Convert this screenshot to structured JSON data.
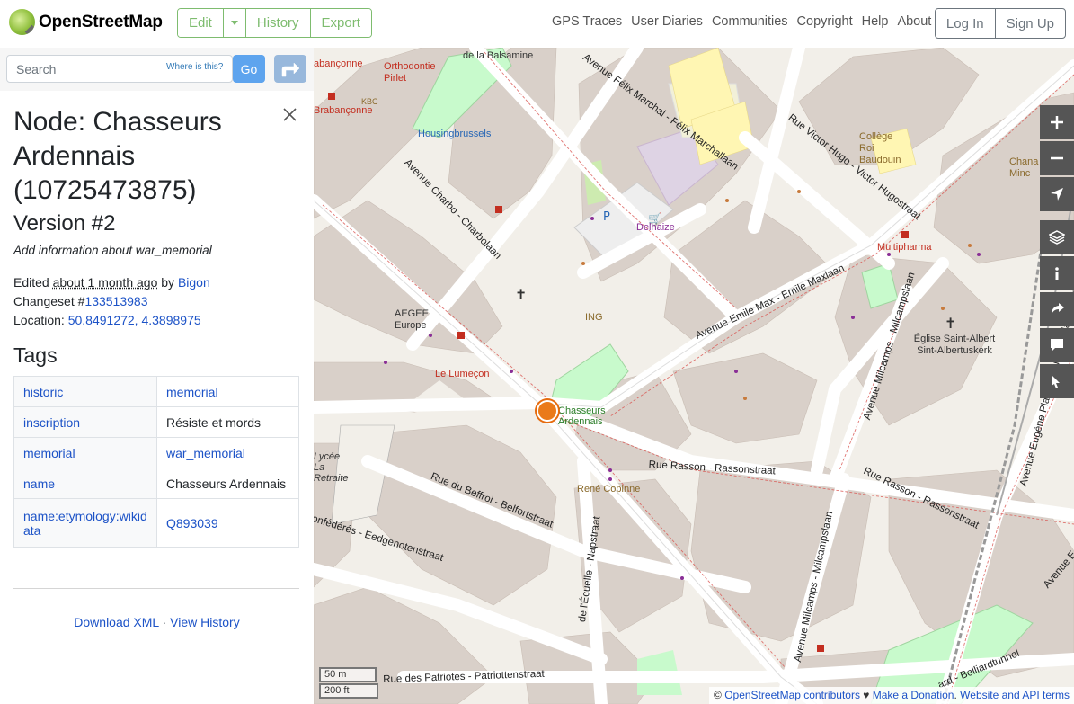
{
  "header": {
    "logo_text": "OpenStreetMap",
    "edit_group": {
      "edit_label": "Edit",
      "history_label": "History",
      "export_label": "Export"
    },
    "nav": [
      "GPS Traces",
      "User Diaries",
      "Communities",
      "Copyright",
      "Help",
      "About"
    ],
    "auth": {
      "login_label": "Log In",
      "signup_label": "Sign Up"
    }
  },
  "search": {
    "placeholder": "Search",
    "where_label": "Where is this?",
    "go_label": "Go"
  },
  "node": {
    "title": "Node: Chasseurs Ardennais (10725473875)",
    "version": "Version #2",
    "comment": "Add information about war_memorial",
    "edited_prefix": "Edited ",
    "edited_time": "about 1 month ago",
    "edited_by": " by ",
    "editor": "Bigon",
    "changeset_prefix": "Changeset #",
    "changeset": "133513983",
    "location_prefix": "Location: ",
    "location": "50.8491272, 4.3898975",
    "tags_heading": "Tags",
    "tags": [
      {
        "key": "historic",
        "value": "memorial",
        "value_link": true
      },
      {
        "key": "inscription",
        "value": "Résiste et mords",
        "value_link": false
      },
      {
        "key": "memorial",
        "value": "war_memorial",
        "value_link": true
      },
      {
        "key": "name",
        "value": "Chasseurs Ardennais",
        "value_link": false
      },
      {
        "key": "name:etymology:wikidata",
        "value": "Q893039",
        "value_link": true
      }
    ],
    "download_xml": "Download XML",
    "separator": " · ",
    "view_history": "View History"
  },
  "map": {
    "labels": {
      "orthodontie": "Orthodontie Pirlet",
      "housing": "Housingbrussels",
      "college": "Collège Roi Baudouin",
      "chana": "Chana Minc",
      "delhaize": "Delhaize",
      "multipharma": "Multipharma",
      "aegee": "AEGEE Europe",
      "ing": "ING",
      "eglise": "Église Saint-Albert Sint-Albertuskerk",
      "lumecon": "Le Lumeçon",
      "chasseurs": "Chasseurs Ardennais",
      "lycee": "Lycée La Retraite",
      "rene": "René Copinne",
      "kbc": "KBC",
      "brabanconne_top": "abançonne",
      "brabanconne": "Brabançonne",
      "balsamine": "de la Balsamine"
    },
    "streets": {
      "felix": "Avenue Félix Marchal - Félix Marchallaan",
      "hugo": "Rue Victor Hugo - Victor Hugostraat",
      "charbo": "Avenue Charbo - Charbolaan",
      "emile": "Avenue Emile Max - Emile Maxlaan",
      "millcamps1": "Avenue Milcamps - Milcampslaan",
      "plasky": "Avenue Eugène Plasky - Eugène Plaskylaan",
      "rasson": "Rue Rasson - Rassonstraat",
      "rasson2": "Rue Rasson - Rassonstraat",
      "beffroi": "Rue du Beffroi - Belfortstraat",
      "confederes": "onfédérés - Eedgenotenstraat",
      "ecuelle": "de l'Écuelle - Napstraat",
      "millcamps2": "Avenue Milcamps - Milcampslaan",
      "patriotes": "Rue des Patriotes - Patriottenstraat",
      "belliard": "ard - Belliardtunnel",
      "avenue_e": "Avenue E"
    },
    "scale_m": "50 m",
    "scale_ft": "200 ft",
    "attribution": {
      "copy": "© ",
      "contributors": "OpenStreetMap contributors",
      "heart": " ♥ ",
      "donation": "Make a Donation",
      "dot": ". ",
      "terms": "Website and API terms"
    }
  }
}
